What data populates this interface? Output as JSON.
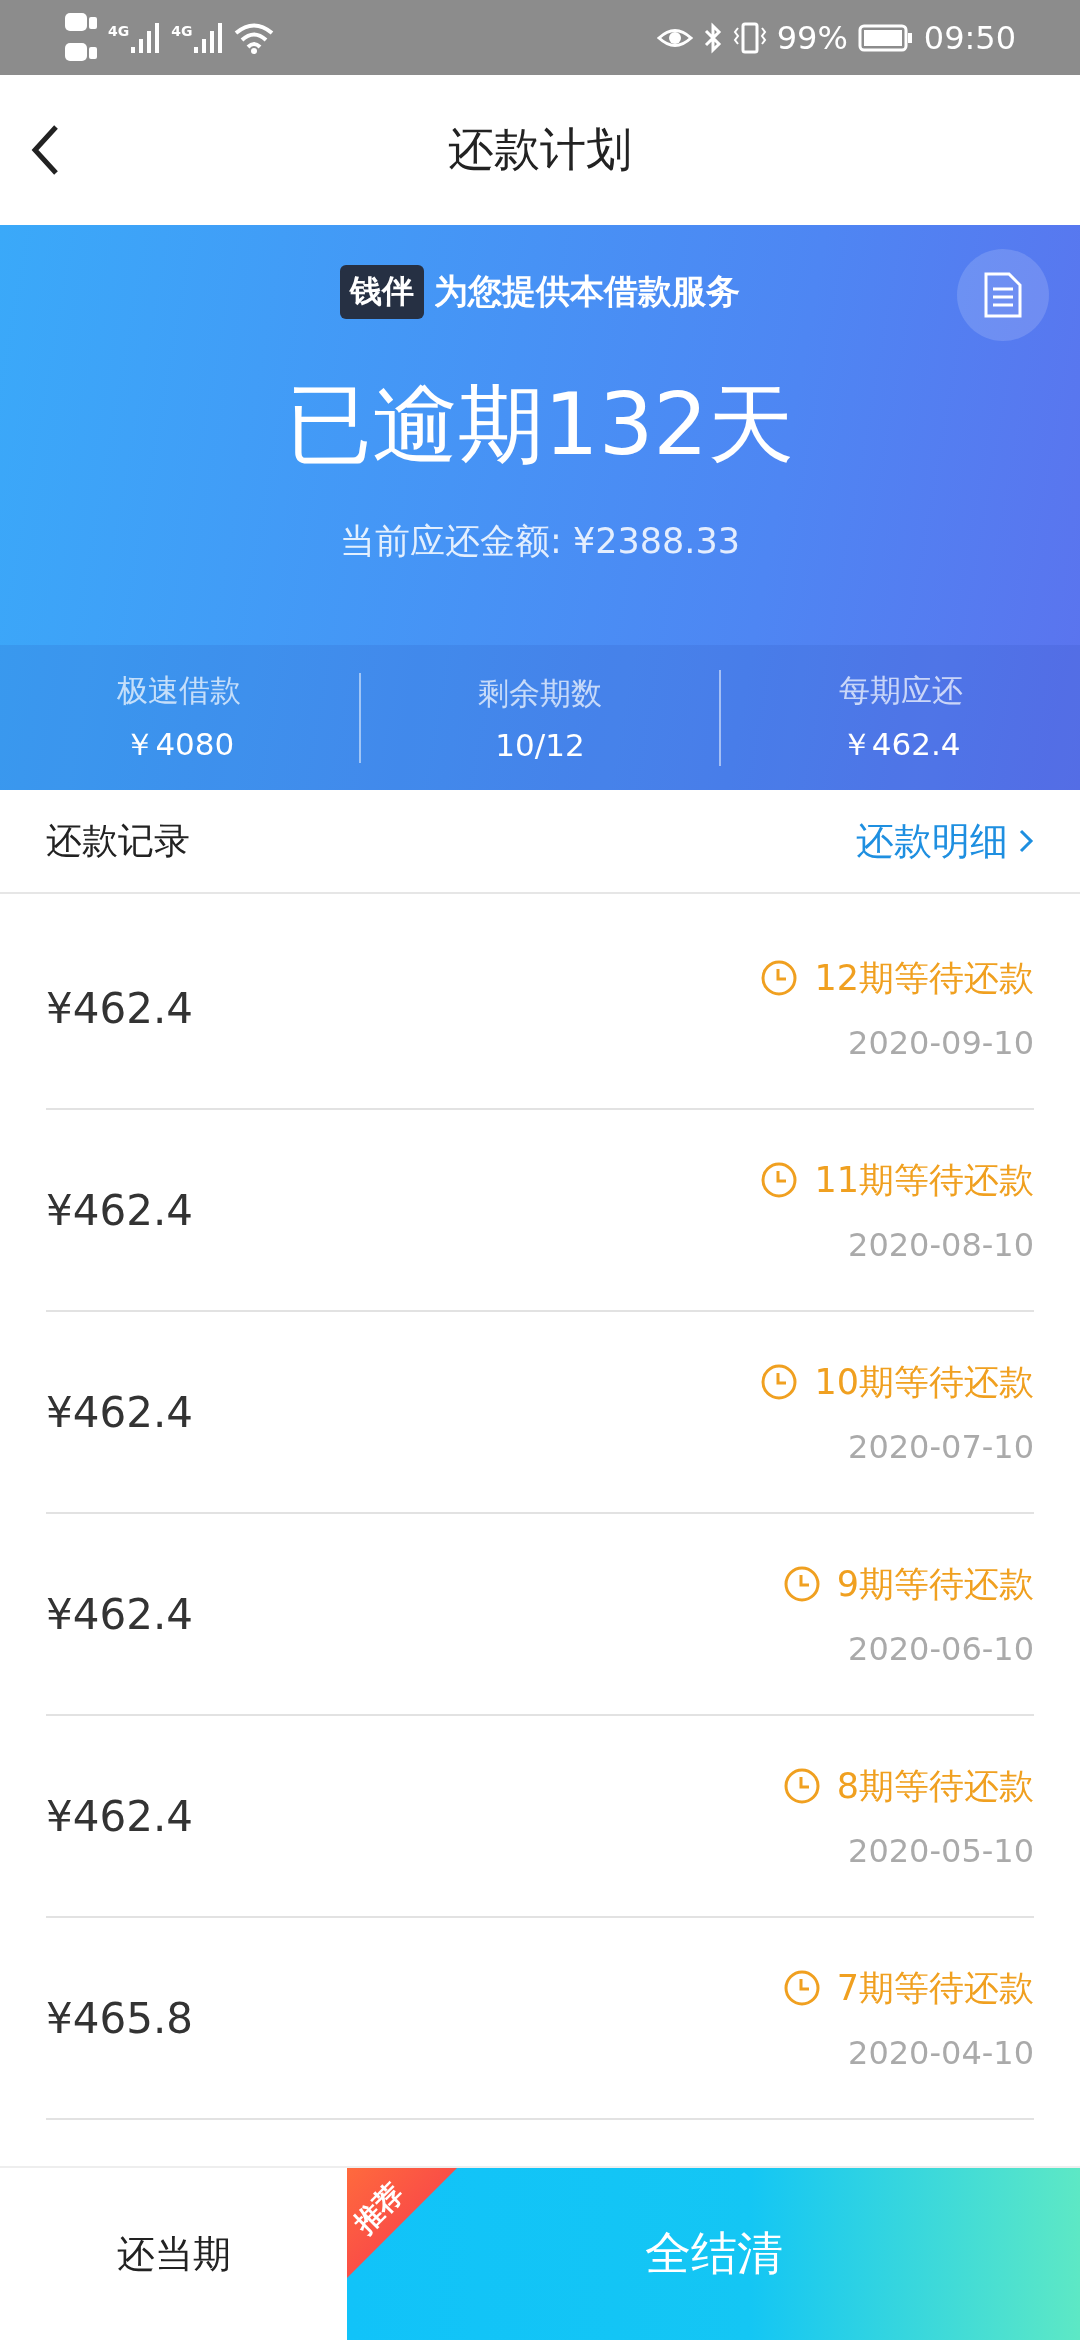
{
  "status_bar": {
    "network_1": "4G",
    "network_2": "4G",
    "battery": "99%",
    "time": "09:50"
  },
  "nav": {
    "title": "还款计划"
  },
  "banner": {
    "brand": "钱伴",
    "provider_text": "为您提供本借款服务",
    "headline": "已逾期132天",
    "amount_text": "当前应还金额: ¥2388.33",
    "stats": [
      {
        "label": "极速借款",
        "value": "￥4080"
      },
      {
        "label": "剩余期数",
        "value": "10/12"
      },
      {
        "label": "每期应还",
        "value": "￥462.4"
      }
    ]
  },
  "records": {
    "title": "还款记录",
    "detail_link": "还款明细"
  },
  "rows": [
    {
      "amount": "¥462.4",
      "status": "12期等待还款",
      "kind": "waiting",
      "date": "2020-09-10"
    },
    {
      "amount": "¥462.4",
      "status": "11期等待还款",
      "kind": "waiting",
      "date": "2020-08-10"
    },
    {
      "amount": "¥462.4",
      "status": "10期等待还款",
      "kind": "waiting",
      "date": "2020-07-10"
    },
    {
      "amount": "¥462.4",
      "status": "9期等待还款",
      "kind": "waiting",
      "date": "2020-06-10"
    },
    {
      "amount": "¥462.4",
      "status": "8期等待还款",
      "kind": "waiting",
      "date": "2020-05-10"
    },
    {
      "amount": "¥465.8",
      "status": "7期等待还款",
      "kind": "waiting",
      "date": "2020-04-10"
    }
  ],
  "bottom": {
    "pay_current": "还当期",
    "pay_all": "全结清",
    "ribbon": "推荐"
  }
}
